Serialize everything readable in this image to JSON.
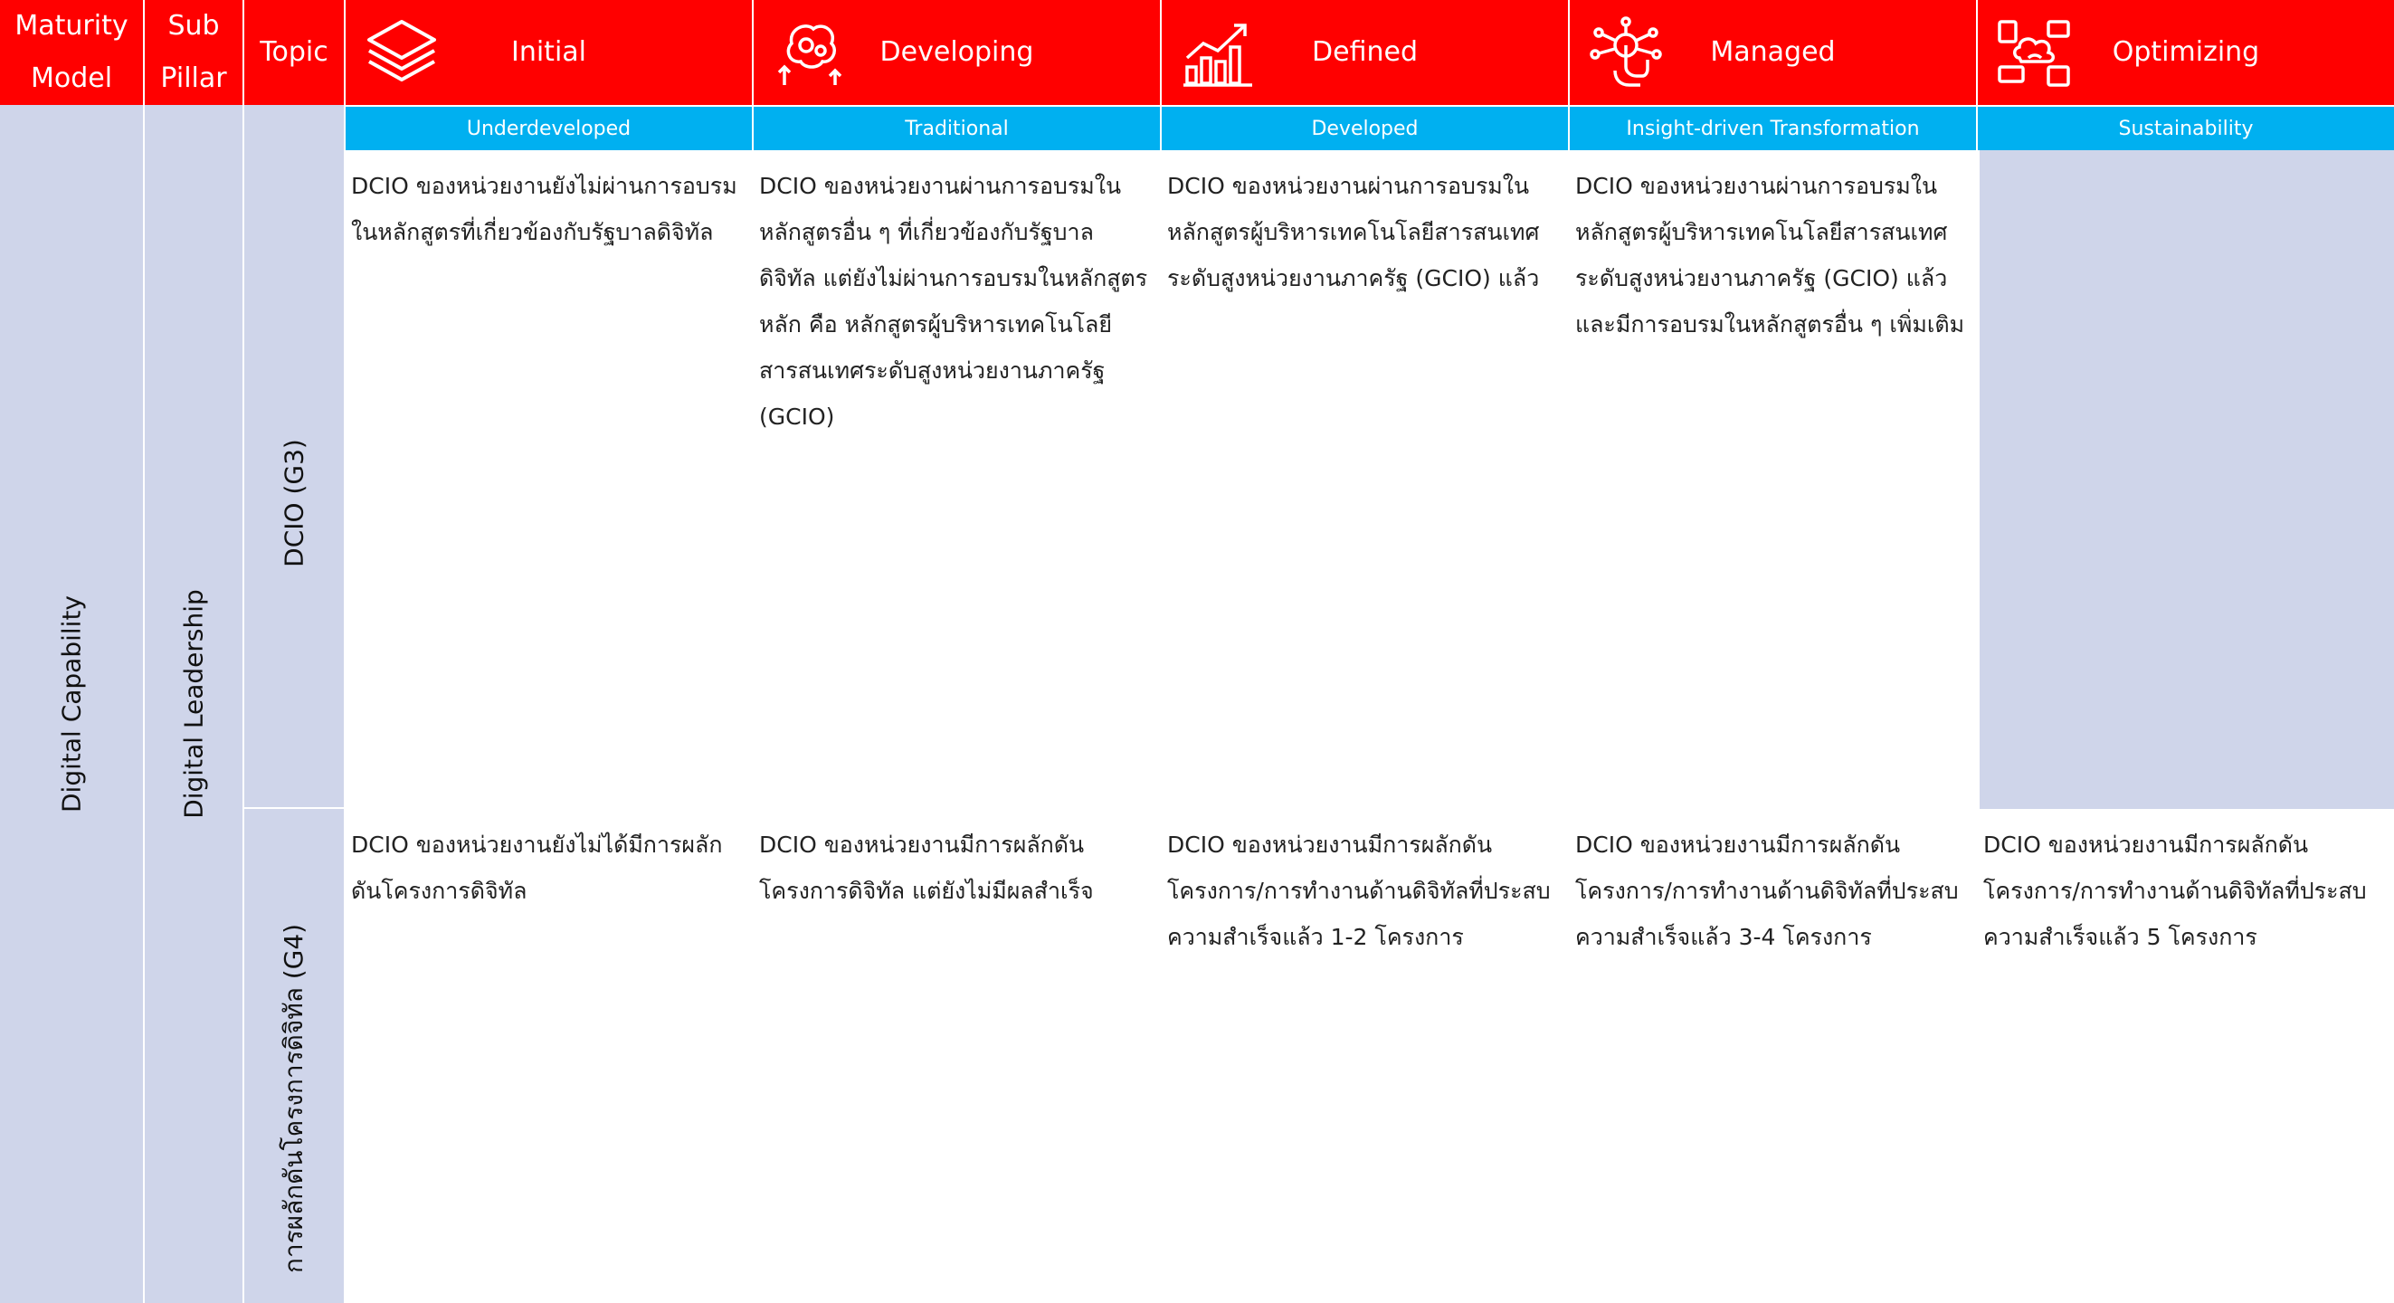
{
  "header": {
    "maturity_model": [
      "Maturity",
      "Model"
    ],
    "sub_pillar": [
      "Sub",
      "Pillar"
    ],
    "topic": "Topic"
  },
  "levels": [
    {
      "name": "Initial",
      "sub": "Underdeveloped",
      "icon": "layers-icon"
    },
    {
      "name": "Developing",
      "sub": "Traditional",
      "icon": "brain-gears-icon"
    },
    {
      "name": "Defined",
      "sub": "Developed",
      "icon": "growth-chart-icon"
    },
    {
      "name": "Managed",
      "sub": "Insight-driven Transformation",
      "icon": "touch-network-icon"
    },
    {
      "name": "Optimizing",
      "sub": "Sustainability",
      "icon": "cloud-devices-icon"
    }
  ],
  "maturity_model_value": "Digital Capability",
  "sub_pillar_value": "Digital Leadership",
  "topics": [
    {
      "label": "DCIO (G3)",
      "cells": [
        "DCIO ของหน่วยงานยังไม่ผ่านการอบรมในหลักสูตรที่เกี่ยวข้องกับรัฐบาลดิจิทัล",
        "DCIO ของหน่วยงานผ่านการอบรมในหลักสูตรอื่น ๆ ที่เกี่ยวข้องกับรัฐบาลดิจิทัล แต่ยังไม่ผ่านการอบรมในหลักสูตรหลัก คือ หลักสูตรผู้บริหารเทคโนโลยีสารสนเทศระดับสูงหน่วยงานภาครัฐ (GCIO)",
        "DCIO ของหน่วยงานผ่านการอบรมในหลักสูตรผู้บริหารเทคโนโลยีสารสนเทศระดับสูงหน่วยงานภาครัฐ (GCIO) แล้ว",
        "DCIO ของหน่วยงานผ่านการอบรมในหลักสูตรผู้บริหารเทคโนโลยีสารสนเทศระดับสูงหน่วยงานภาครัฐ (GCIO) แล้ว และมีการอบรมในหลักสูตรอื่น ๆ เพิ่มเติม",
        ""
      ]
    },
    {
      "label": "การผลักดันโครงการดิจิทัล (G4)",
      "cells": [
        "DCIO ของหน่วยงานยังไม่ได้มีการผลักดันโครงการดิจิทัล",
        "DCIO ของหน่วยงานมีการผลักดันโครงการดิจิทัล แต่ยังไม่มีผลสำเร็จ",
        "DCIO ของหน่วยงานมีการผลักดันโครงการ/การทำงานด้านดิจิทัลที่ประสบความสำเร็จแล้ว 1-2 โครงการ",
        "DCIO ของหน่วยงานมีการผลักดันโครงการ/การทำงานด้านดิจิทัลที่ประสบความสำเร็จแล้ว 3-4 โครงการ",
        "DCIO ของหน่วยงานมีการผลักดันโครงการ/การทำงานด้านดิจิทัลที่ประสบความสำเร็จแล้ว 5 โครงการ"
      ]
    }
  ],
  "colors": {
    "header_red": "#ff0000",
    "header_blue": "#00b0f0",
    "side_fill": "#cfd5ea"
  }
}
